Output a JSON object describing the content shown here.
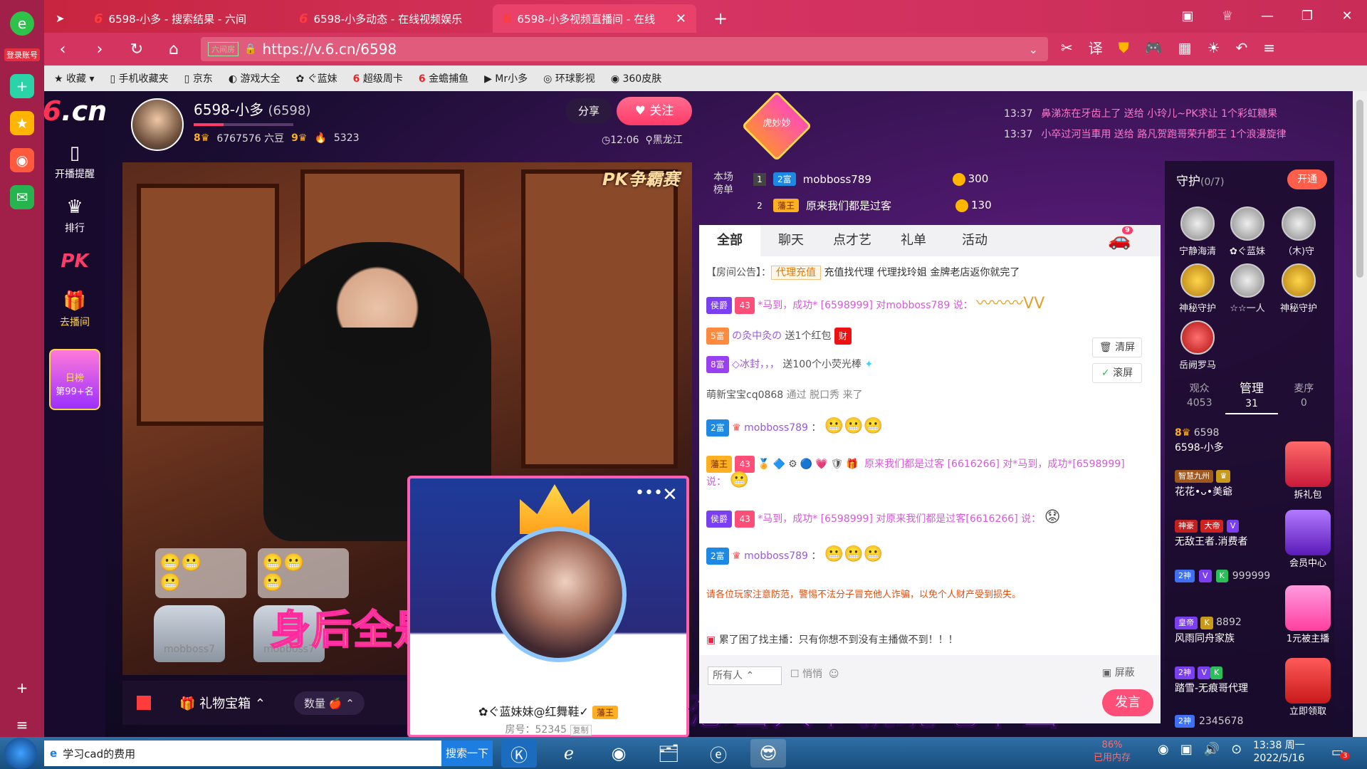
{
  "browser": {
    "tabs": [
      {
        "title": "6598-小多 - 搜索结果 - 六间"
      },
      {
        "title": "6598-小多动态 - 在线视频娱乐"
      },
      {
        "title": "6598-小多视频直播间 - 在线"
      }
    ],
    "login": "登录账号",
    "url": "https://v.6.cn/6598",
    "url_tag": "六间房",
    "bookmarks": [
      "收藏",
      "手机收藏夹",
      "京东",
      "游戏大全",
      "ぐ蓝妹",
      "超级周卡",
      "金蟾捕鱼",
      "Mr小多",
      "环球影视",
      "360皮肤"
    ]
  },
  "site": {
    "logo_main": "6",
    "logo_sub": ".cn",
    "logo_top": "六间房",
    "nav": [
      {
        "icon": "phone-icon",
        "label": "开播提醒"
      },
      {
        "icon": "crown-icon",
        "label": "排行"
      },
      {
        "icon": "pk-icon",
        "label": ""
      },
      {
        "icon": "gift-icon",
        "label": "去播间"
      }
    ],
    "rank_title": "日榜",
    "rank_value": "第99+名"
  },
  "anchor": {
    "name": "6598-小多",
    "id": "(6598)",
    "level_left": "8",
    "beans": "6767576 六豆",
    "level_right": "9",
    "fire": "5323",
    "share": "分享",
    "follow": "关注",
    "time": "12:06",
    "location": "黑龙江",
    "badge": "虎妙妙"
  },
  "ticker": [
    {
      "time": "13:37",
      "text": "鼻涕冻在牙齿上了 送给 小玲儿~PK求让 1个彩虹糖果"
    },
    {
      "time": "13:37",
      "text": "小卒过河当車用 送给 路凡贺跑哥荣升郡王 1个浪漫旋律"
    }
  ],
  "video": {
    "pk_logo": "PK争霸赛",
    "seats": [
      {
        "user": "mobboss7"
      },
      {
        "user": "mobboss7"
      }
    ],
    "lyric_top": "身后全是这废弃的光",
    "lyric_bottom": "想当大爷就跪地下当",
    "gift_box": "礼物宝箱",
    "qty_label": "数量"
  },
  "popup": {
    "name": "✿ぐ蓝妹妹@红舞鞋✓",
    "role": "藩王",
    "room": "房号：52345",
    "copy": "复制"
  },
  "rank_top": {
    "label": "本场榜单",
    "rows": [
      {
        "n": "1",
        "badge": "2富",
        "user": "mobboss789",
        "coins": "300"
      },
      {
        "n": "2",
        "badge": "藩王",
        "user": "原来我们都是过客",
        "coins": "130"
      }
    ]
  },
  "chat": {
    "tabs": [
      "全部",
      "聊天",
      "点才艺",
      "礼单",
      "活动"
    ],
    "car_count": "9",
    "announcement_label": "【房间公告】：",
    "announcement_tag": "代理充值",
    "announcement_text": "充值找代理 代理找玲姐 金牌老店返你就完了",
    "messages": [
      {
        "badge": "侯爵",
        "lvl": "43",
        "text": "*马到，成功* [6598999] 对mobboss789 说：",
        "emoji": "〰〰〰VV"
      },
      {
        "badge": "5富",
        "user": "の灸中灸の",
        "text": "送1个红包",
        "emoji": "财"
      },
      {
        "badge": "8富",
        "user": "◇冰封，，，",
        "text": "送100个小荧光棒",
        "emoji": "✦"
      },
      {
        "badge": "",
        "user": "萌新宝宝cq0868",
        "text": "通过 脱口秀 来了",
        "emoji": ""
      },
      {
        "badge": "2富",
        "user": "mobboss789",
        "text": "：",
        "emoji": "😬😬😬"
      },
      {
        "badge": "藩王",
        "lvl": "43",
        "user": "原来我们都是过客",
        "text": "[6616266] 对*马到，成功*[6598999] 说：",
        "emoji": "😬"
      },
      {
        "badge": "侯爵",
        "lvl": "43",
        "text": "*马到，成功* [6598999] 对原来我们都是过客[6616266] 说：",
        "emoji": "😟"
      },
      {
        "badge": "2富",
        "user": "mobboss789",
        "text": "：",
        "emoji": "😬😬😬"
      }
    ],
    "clear": "清屏",
    "scroll": "滚屏",
    "notice": "请各位玩家注意防范，警惕不法分子冒充他人诈骗，以免个人财产受到损失。",
    "tip": "累了困了找主播：只有你想不到没有主播做不到！！！",
    "all_people": "所有人",
    "quiet": "悄悄",
    "mask": "屏蔽",
    "send": "发言"
  },
  "guard": {
    "title": "守护",
    "count": "(0/7)",
    "open": "开通",
    "members": [
      "宁静海清",
      "✿ぐ蓝妹",
      "（木)守",
      "神秘守护",
      "☆☆一人",
      "神秘守护",
      "岳阙罗马"
    ]
  },
  "viewers": {
    "tabs": [
      {
        "label": "观众",
        "count": "4053"
      },
      {
        "label": "管理",
        "count": "31"
      },
      {
        "label": "麦序",
        "count": "0"
      }
    ],
    "list": [
      {
        "name": "6598-小多",
        "sub": "6598"
      },
      {
        "name": "花花•ᴗ•美爺",
        "sub": ""
      },
      {
        "name": "无敌王者.消费者",
        "sub": ""
      },
      {
        "name": "",
        "sub": "999999"
      },
      {
        "name": "风雨同舟家族",
        "sub": "8892"
      },
      {
        "name": "踏雪-无痕哥代理",
        "sub": ""
      },
      {
        "name": "",
        "sub": "2345678"
      }
    ],
    "promos": [
      "拆礼包",
      "会员中心",
      "1元被主播",
      "立即领取"
    ]
  },
  "taskbar": {
    "search_text": "学习cad的费用",
    "search_btn": "搜索一下",
    "mem_pct": "86%",
    "mem_label": "已用内存",
    "time": "13:38 周一",
    "date": "2022/5/16",
    "notif": "3"
  },
  "colors": {
    "accent": "#ff4f78",
    "chrome": "#d33560",
    "purple": "#9b57d8"
  }
}
